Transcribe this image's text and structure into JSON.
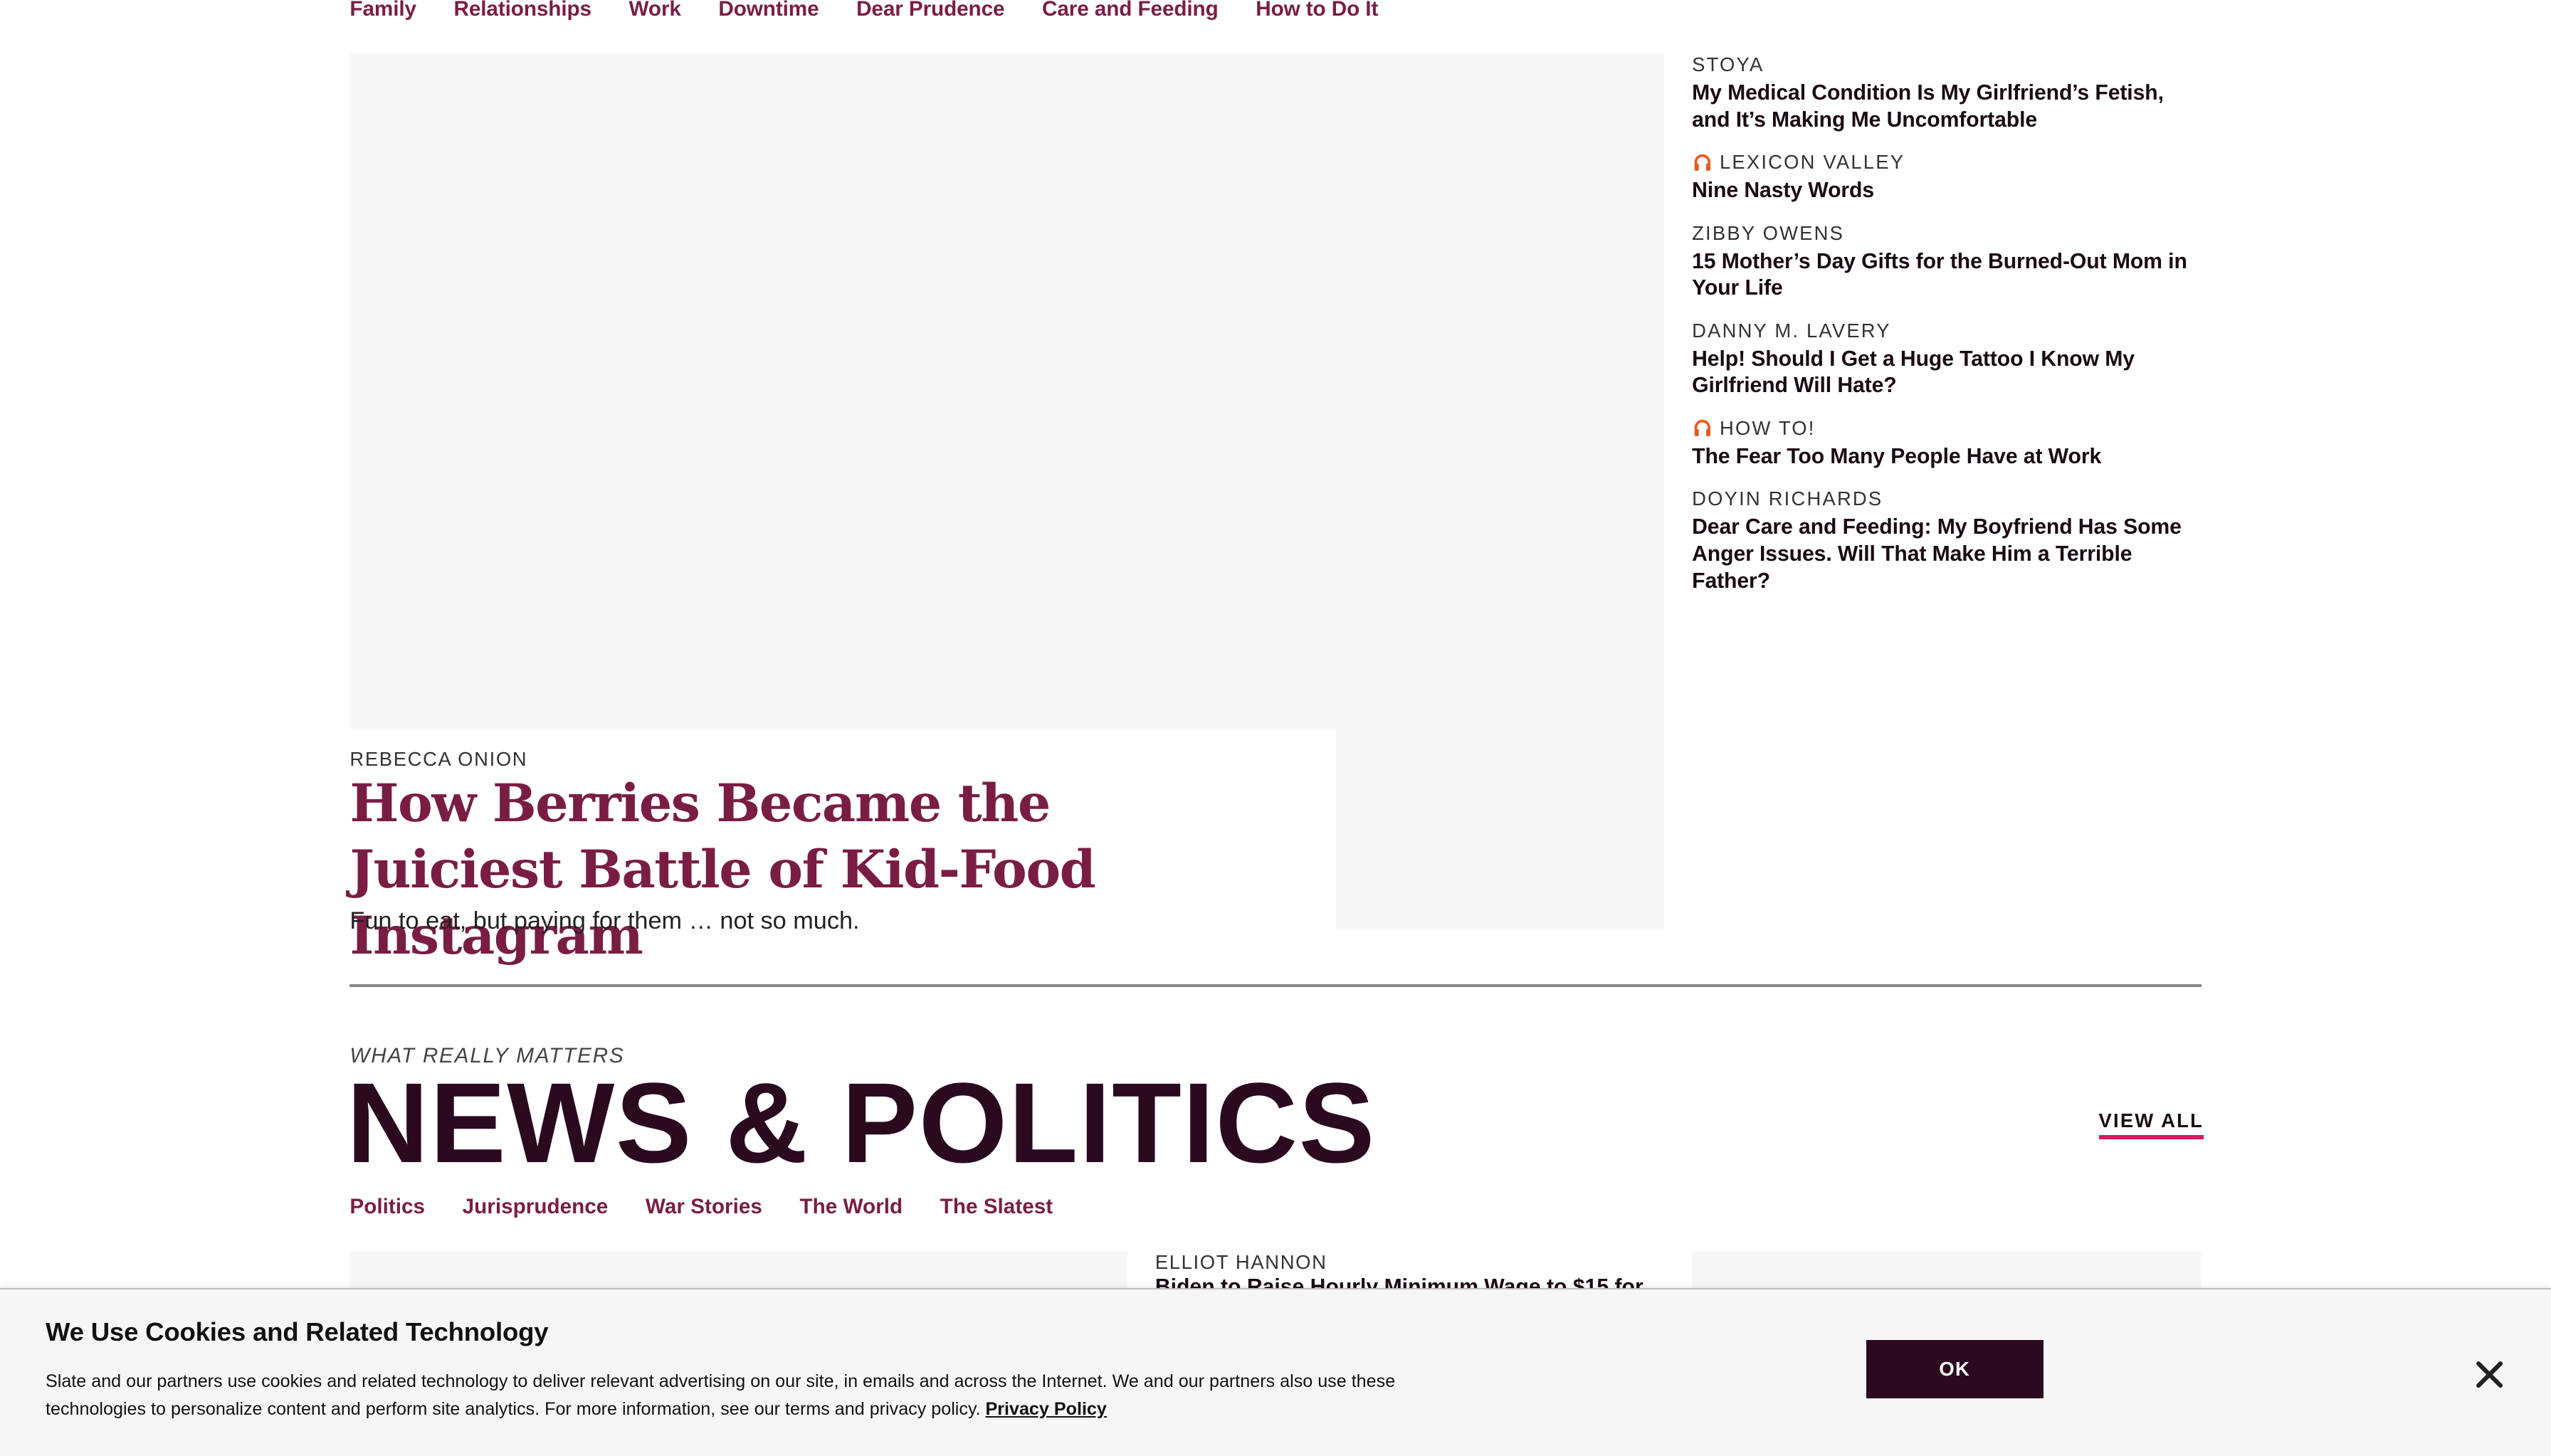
{
  "top_nav": [
    "Family",
    "Relationships",
    "Work",
    "Downtime",
    "Dear Prudence",
    "Care and Feeding",
    "How to Do It"
  ],
  "hero": {
    "author": "REBECCA ONION",
    "title": "How Berries Became the Juiciest Battle of Kid-Food Instagram",
    "dek": "Fun to eat, but paying for them … not so much."
  },
  "sidebar": [
    {
      "kicker": "STOYA",
      "podcast": false,
      "headline": "My Medical Condition Is My Girlfriend’s Fetish, and It’s Making Me Uncomfortable"
    },
    {
      "kicker": "LEXICON VALLEY",
      "podcast": true,
      "headline": "Nine Nasty Words"
    },
    {
      "kicker": "ZIBBY OWENS",
      "podcast": false,
      "headline": "15 Mother’s Day Gifts for the Burned-Out Mom in Your Life"
    },
    {
      "kicker": "DANNY M. LAVERY",
      "podcast": false,
      "headline": "Help! Should I Get a Huge Tattoo I Know My Girlfriend Will Hate?"
    },
    {
      "kicker": "HOW TO!",
      "podcast": true,
      "headline": "The Fear Too Many People Have at Work"
    },
    {
      "kicker": "DOYIN RICHARDS",
      "podcast": false,
      "headline": "Dear Care and Feeding: My Boyfriend Has Some Anger Issues. Will That Make Him a Terrible Father?"
    }
  ],
  "news_section": {
    "eyebrow": "WHAT REALLY MATTERS",
    "title": "NEWS & POLITICS",
    "view_all": "VIEW ALL",
    "tabs": [
      "Politics",
      "Jurisprudence",
      "War Stories",
      "The World",
      "The Slatest"
    ],
    "story_author": "ELLIOT HANNON",
    "story_headline": "Biden to Raise Hourly Minimum Wage to $15 for"
  },
  "cookie": {
    "title": "We Use Cookies and Related Technology",
    "body": "Slate and our partners use cookies and related technology to deliver relevant advertising on our site, in emails and across the Internet. We and our partners also use these technologies to personalize content and perform site analytics. For more information, see our terms and privacy policy.",
    "link": "Privacy Policy",
    "ok": "OK"
  },
  "colors": {
    "accent": "#7a1d45",
    "dark": "#2b0a20",
    "underline": "#e0155d",
    "podcast_icon": "#e85a1c"
  }
}
